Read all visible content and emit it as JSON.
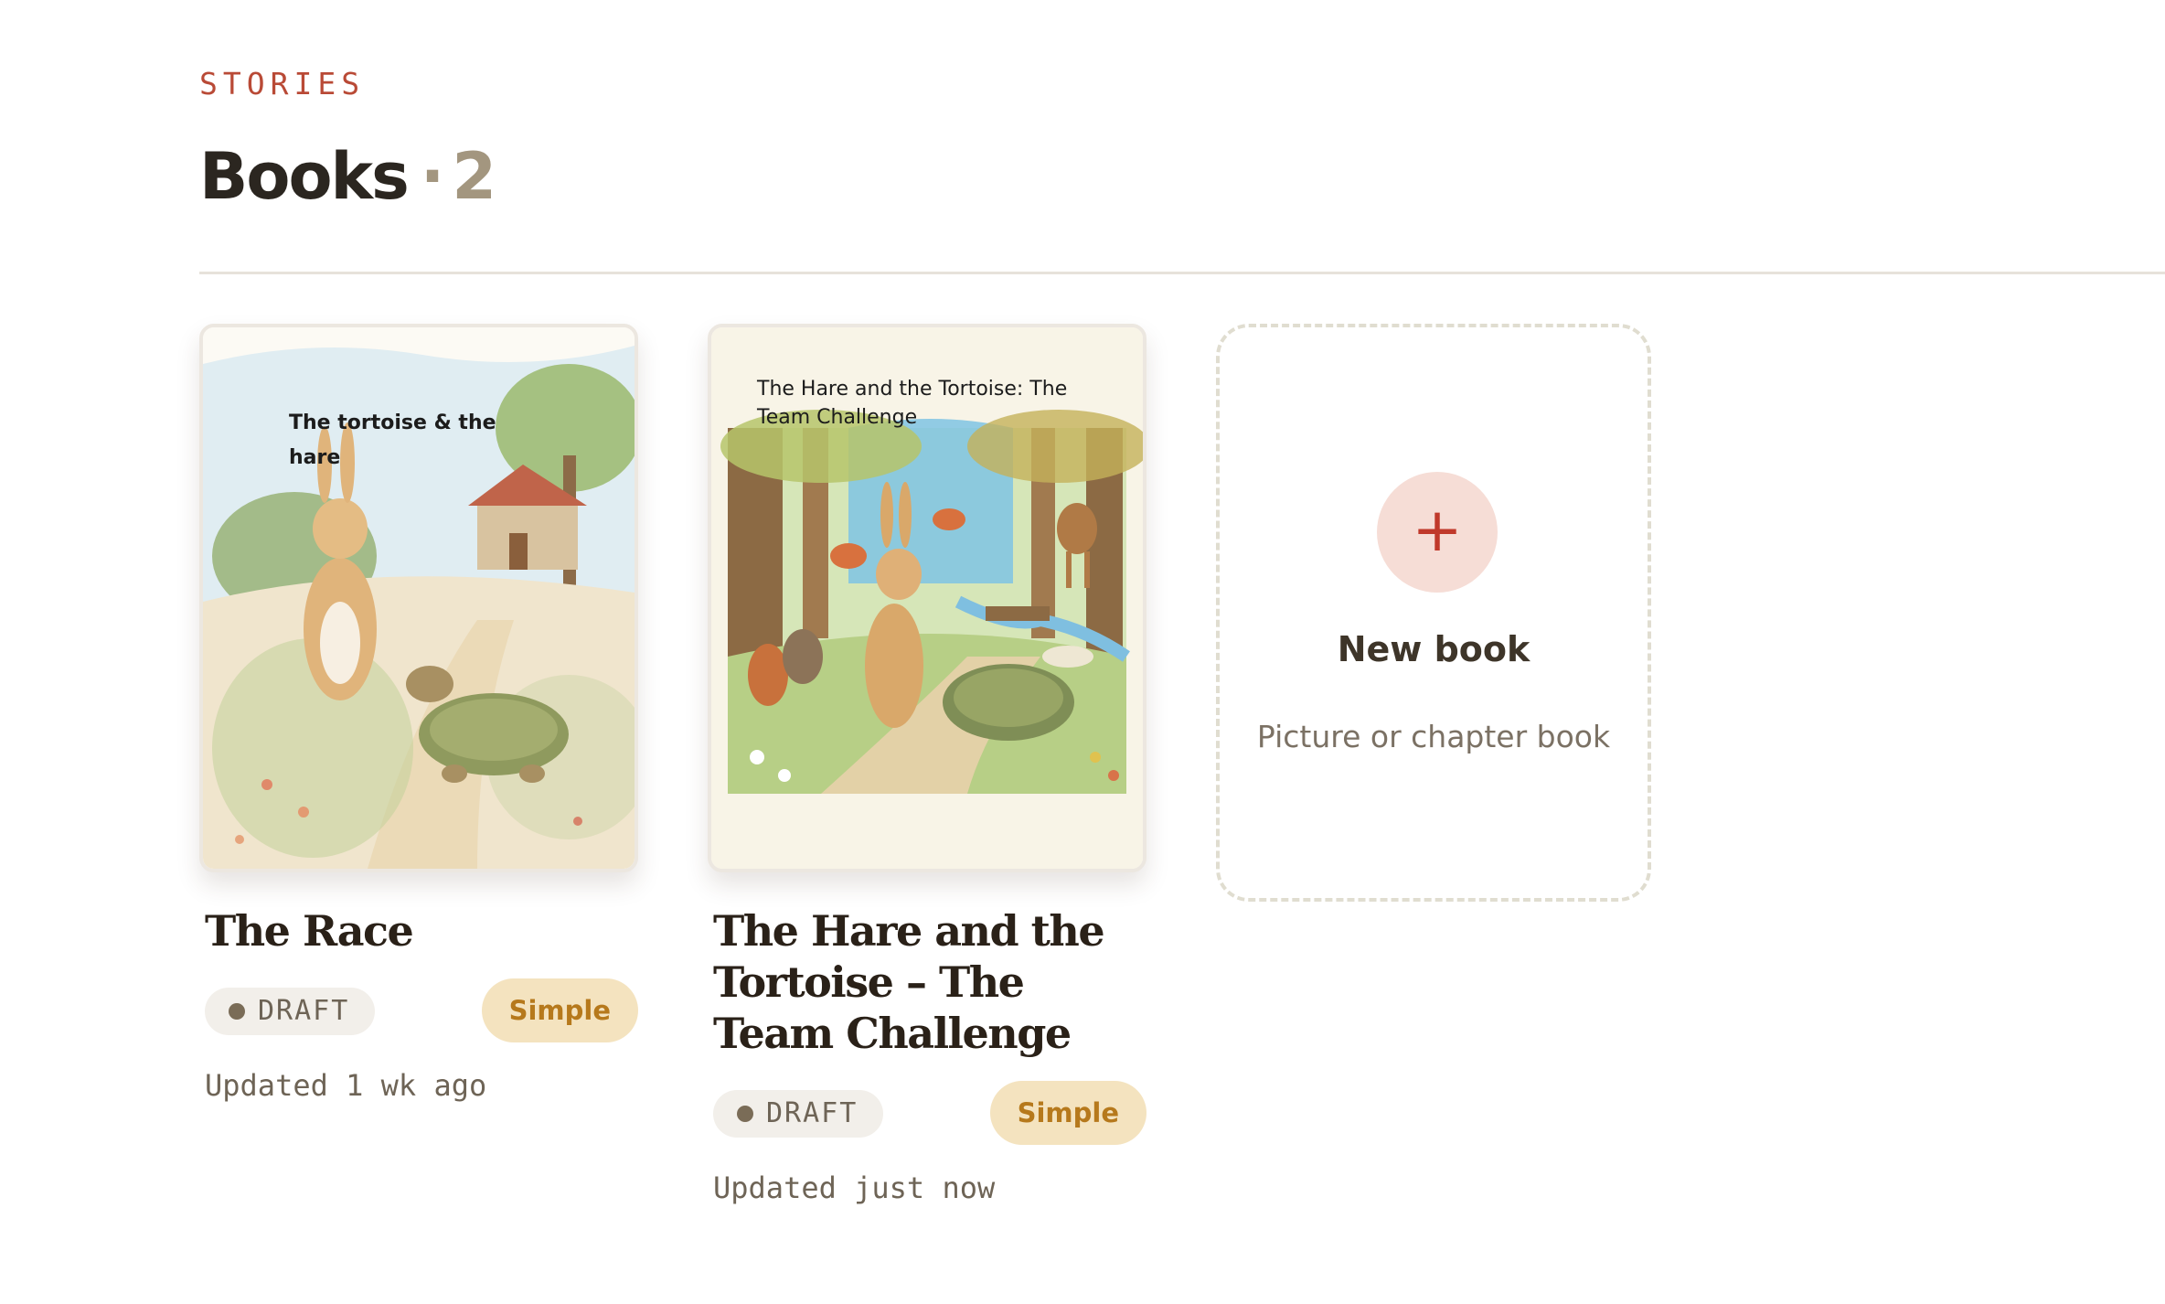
{
  "section_label": "STORIES",
  "header": {
    "title": "Books",
    "separator": "·",
    "count": "2"
  },
  "books": [
    {
      "cover_text": "The tortoise & the hare",
      "title": "The Race",
      "status": "DRAFT",
      "level": "Simple",
      "updated": "Updated 1 wk ago"
    },
    {
      "cover_text": "The Hare and the Tortoise: The Team Challenge",
      "title": "The Hare and the Tortoise – The Team Challenge",
      "status": "DRAFT",
      "level": "Simple",
      "updated": "Updated just now"
    }
  ],
  "new_book": {
    "icon": "plus-icon",
    "symbol": "+",
    "title": "New book",
    "subtitle": "Picture or chapter book"
  },
  "colors": {
    "accent": "#b94a36",
    "level_badge_bg": "#f4e3bf",
    "level_badge_text": "#b6791c",
    "status_badge_bg": "#f2efea"
  }
}
